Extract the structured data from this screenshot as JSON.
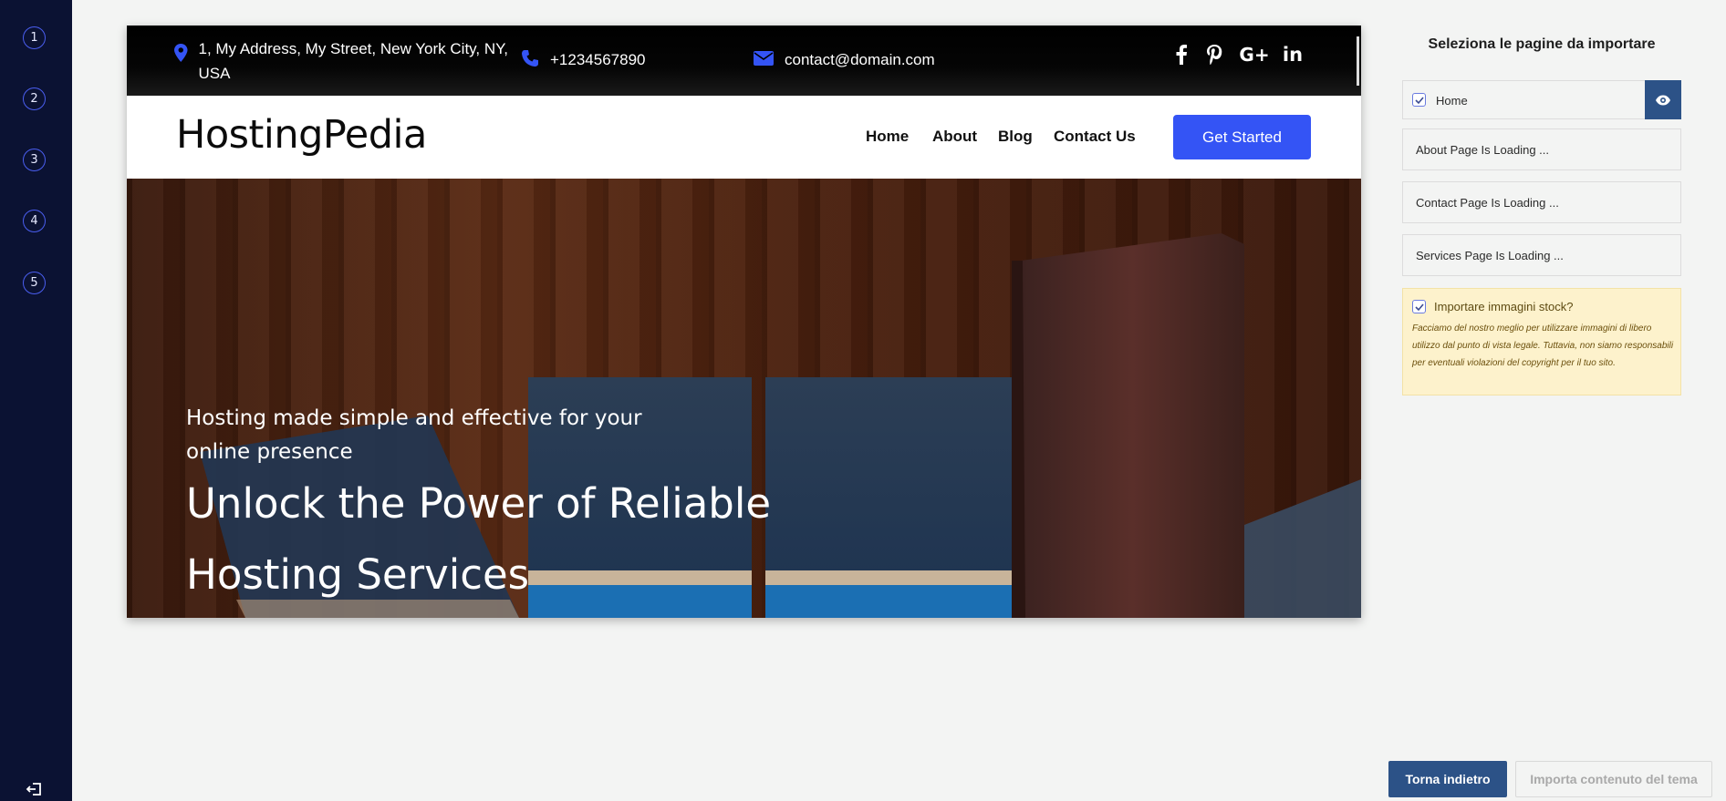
{
  "steps": [
    "1",
    "2",
    "3",
    "4",
    "5"
  ],
  "preview": {
    "topbar": {
      "address": "1, My Address, My Street, New York City, NY, USA",
      "phone": "+1234567890",
      "email": "contact@domain.com",
      "social_icons": [
        "facebook-icon",
        "pinterest-icon",
        "google-plus-icon",
        "linkedin-icon"
      ],
      "google_plus_label": "G+",
      "linkedin_label": "in"
    },
    "header": {
      "brand": "HostingPedia",
      "nav": [
        "Home",
        "About",
        "Blog",
        "Contact Us"
      ],
      "cta": "Get Started"
    },
    "hero": {
      "subtitle": "Hosting made simple and effective for your online presence",
      "title": "Unlock the Power of Reliable Hosting Services"
    }
  },
  "panel": {
    "title": "Seleziona le pagine da importare",
    "home_label": "Home",
    "loading_pages": [
      "About Page Is Loading ...",
      "Contact Page Is Loading ...",
      "Services Page Is Loading ..."
    ],
    "stock_label": "Importare immagini stock?",
    "stock_notice": "Facciamo del nostro meglio per utilizzare immagini di libero utilizzo dal punto di vista legale. Tuttavia, non siamo responsabili per eventuali violazioni del copyright per il tuo sito."
  },
  "footer": {
    "back": "Torna indietro",
    "import": "Importa contenuto del tema"
  },
  "colors": {
    "rail": "#0b1233",
    "accent_blue": "#3454f5",
    "button_navy": "#2c5287",
    "notice_bg": "#fdf2cc"
  }
}
